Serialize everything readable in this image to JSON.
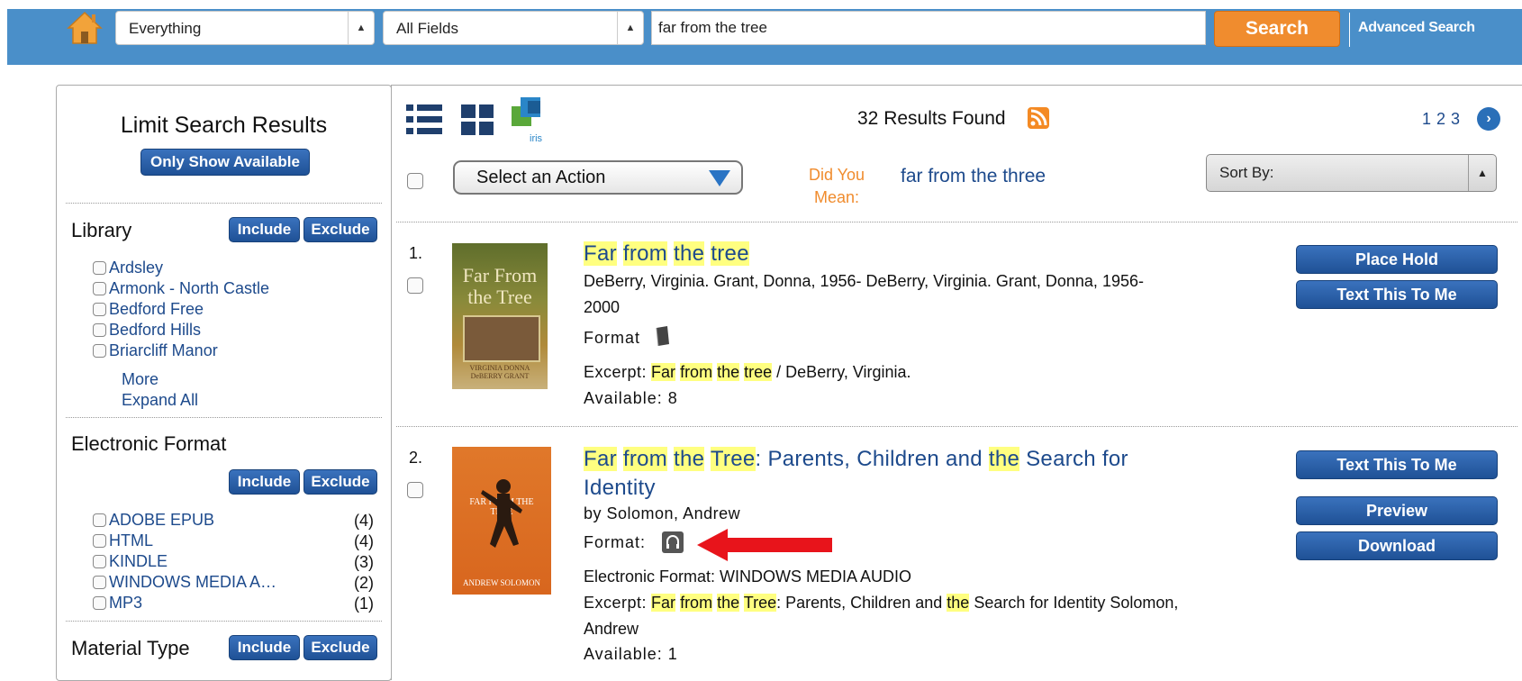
{
  "search": {
    "scope": "Everything",
    "field": "All Fields",
    "query": "far from the tree",
    "search_label": "Search",
    "advanced_label": "Advanced Search"
  },
  "sidebar": {
    "title": "Limit Search Results",
    "only_available": "Only Show Available",
    "include": "Include",
    "exclude": "Exclude",
    "library": {
      "heading": "Library",
      "items": [
        "Ardsley",
        "Armonk - North Castle",
        "Bedford Free",
        "Bedford Hills",
        "Briarcliff Manor"
      ],
      "more": "More",
      "expand_all": "Expand All"
    },
    "electronic_format": {
      "heading": "Electronic Format",
      "items": [
        {
          "label": "ADOBE EPUB",
          "count": "(4)"
        },
        {
          "label": "HTML",
          "count": "(4)"
        },
        {
          "label": "KINDLE",
          "count": "(3)"
        },
        {
          "label": "WINDOWS MEDIA A…",
          "count": "(2)"
        },
        {
          "label": "MP3",
          "count": "(1)"
        }
      ]
    },
    "material_type": {
      "heading": "Material Type"
    }
  },
  "toolbar": {
    "results_found": "32 Results Found",
    "iris_label": "iris",
    "pages": [
      "1",
      "2",
      "3"
    ],
    "action_select": "Select an Action",
    "did_you_mean_1": "Did You",
    "did_you_mean_2": "Mean:",
    "suggestion": "far from the three",
    "sort_by": "Sort By:"
  },
  "results": [
    {
      "num": "1.",
      "title_parts": [
        "Far",
        "from",
        "the",
        "tree"
      ],
      "authors": "DeBerry, Virginia. Grant, Donna, 1956- DeBerry, Virginia. Grant, Donna, 1956-",
      "year": "2000",
      "format_label": "Format",
      "excerpt_label": "Excerpt:",
      "excerpt_rest": "/ DeBerry, Virginia.",
      "available": "Available: 8",
      "buttons": [
        "Place Hold",
        "Text This To Me"
      ],
      "cover_title": "Far From the Tree",
      "cover_authors": "VIRGINIA DONNA DeBERRY GRANT"
    },
    {
      "num": "2.",
      "title_rest": ": Parents, Children and",
      "title_end": "Search for",
      "title_line2": "Identity",
      "by": "by  Solomon, Andrew",
      "format_label": "Format:",
      "electronic_format": "Electronic Format:  WINDOWS MEDIA AUDIO",
      "excerpt_label": "Excerpt:",
      "excerpt_mid": ": Parents, Children and",
      "excerpt_tail": "Search for Identity Solomon,",
      "excerpt_line2": "Andrew",
      "available": "Available: 1",
      "buttons": [
        "Text This To Me",
        "Preview",
        "Download"
      ],
      "cover_title": "FAR FROM THE TREE",
      "cover_author": "ANDREW SOLOMON"
    }
  ],
  "colors": {
    "header_bg": "#4a8fc9",
    "search_button": "#f08c2e",
    "action_blue": "#2a5fa8",
    "link_blue": "#1d4a8c",
    "highlight": "#ffff80",
    "arrow_red": "#e8141b"
  },
  "icons": [
    "home-icon",
    "list-view-icon",
    "grid-view-icon",
    "iris-icon",
    "rss-icon",
    "next-page-icon",
    "book-icon",
    "audiobook-icon"
  ]
}
